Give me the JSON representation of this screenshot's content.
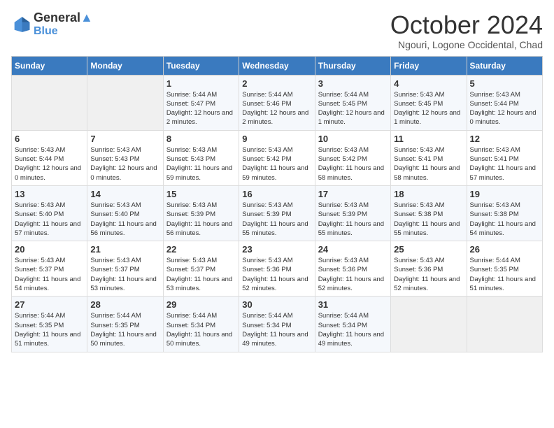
{
  "header": {
    "logo_line1": "General",
    "logo_line2": "Blue",
    "title": "October 2024",
    "subtitle": "Ngouri, Logone Occidental, Chad"
  },
  "days_of_week": [
    "Sunday",
    "Monday",
    "Tuesday",
    "Wednesday",
    "Thursday",
    "Friday",
    "Saturday"
  ],
  "weeks": [
    [
      {
        "day": "",
        "info": ""
      },
      {
        "day": "",
        "info": ""
      },
      {
        "day": "1",
        "info": "Sunrise: 5:44 AM\nSunset: 5:47 PM\nDaylight: 12 hours and 2 minutes."
      },
      {
        "day": "2",
        "info": "Sunrise: 5:44 AM\nSunset: 5:46 PM\nDaylight: 12 hours and 2 minutes."
      },
      {
        "day": "3",
        "info": "Sunrise: 5:44 AM\nSunset: 5:45 PM\nDaylight: 12 hours and 1 minute."
      },
      {
        "day": "4",
        "info": "Sunrise: 5:43 AM\nSunset: 5:45 PM\nDaylight: 12 hours and 1 minute."
      },
      {
        "day": "5",
        "info": "Sunrise: 5:43 AM\nSunset: 5:44 PM\nDaylight: 12 hours and 0 minutes."
      }
    ],
    [
      {
        "day": "6",
        "info": "Sunrise: 5:43 AM\nSunset: 5:44 PM\nDaylight: 12 hours and 0 minutes."
      },
      {
        "day": "7",
        "info": "Sunrise: 5:43 AM\nSunset: 5:43 PM\nDaylight: 12 hours and 0 minutes."
      },
      {
        "day": "8",
        "info": "Sunrise: 5:43 AM\nSunset: 5:43 PM\nDaylight: 11 hours and 59 minutes."
      },
      {
        "day": "9",
        "info": "Sunrise: 5:43 AM\nSunset: 5:42 PM\nDaylight: 11 hours and 59 minutes."
      },
      {
        "day": "10",
        "info": "Sunrise: 5:43 AM\nSunset: 5:42 PM\nDaylight: 11 hours and 58 minutes."
      },
      {
        "day": "11",
        "info": "Sunrise: 5:43 AM\nSunset: 5:41 PM\nDaylight: 11 hours and 58 minutes."
      },
      {
        "day": "12",
        "info": "Sunrise: 5:43 AM\nSunset: 5:41 PM\nDaylight: 11 hours and 57 minutes."
      }
    ],
    [
      {
        "day": "13",
        "info": "Sunrise: 5:43 AM\nSunset: 5:40 PM\nDaylight: 11 hours and 57 minutes."
      },
      {
        "day": "14",
        "info": "Sunrise: 5:43 AM\nSunset: 5:40 PM\nDaylight: 11 hours and 56 minutes."
      },
      {
        "day": "15",
        "info": "Sunrise: 5:43 AM\nSunset: 5:39 PM\nDaylight: 11 hours and 56 minutes."
      },
      {
        "day": "16",
        "info": "Sunrise: 5:43 AM\nSunset: 5:39 PM\nDaylight: 11 hours and 55 minutes."
      },
      {
        "day": "17",
        "info": "Sunrise: 5:43 AM\nSunset: 5:39 PM\nDaylight: 11 hours and 55 minutes."
      },
      {
        "day": "18",
        "info": "Sunrise: 5:43 AM\nSunset: 5:38 PM\nDaylight: 11 hours and 55 minutes."
      },
      {
        "day": "19",
        "info": "Sunrise: 5:43 AM\nSunset: 5:38 PM\nDaylight: 11 hours and 54 minutes."
      }
    ],
    [
      {
        "day": "20",
        "info": "Sunrise: 5:43 AM\nSunset: 5:37 PM\nDaylight: 11 hours and 54 minutes."
      },
      {
        "day": "21",
        "info": "Sunrise: 5:43 AM\nSunset: 5:37 PM\nDaylight: 11 hours and 53 minutes."
      },
      {
        "day": "22",
        "info": "Sunrise: 5:43 AM\nSunset: 5:37 PM\nDaylight: 11 hours and 53 minutes."
      },
      {
        "day": "23",
        "info": "Sunrise: 5:43 AM\nSunset: 5:36 PM\nDaylight: 11 hours and 52 minutes."
      },
      {
        "day": "24",
        "info": "Sunrise: 5:43 AM\nSunset: 5:36 PM\nDaylight: 11 hours and 52 minutes."
      },
      {
        "day": "25",
        "info": "Sunrise: 5:43 AM\nSunset: 5:36 PM\nDaylight: 11 hours and 52 minutes."
      },
      {
        "day": "26",
        "info": "Sunrise: 5:44 AM\nSunset: 5:35 PM\nDaylight: 11 hours and 51 minutes."
      }
    ],
    [
      {
        "day": "27",
        "info": "Sunrise: 5:44 AM\nSunset: 5:35 PM\nDaylight: 11 hours and 51 minutes."
      },
      {
        "day": "28",
        "info": "Sunrise: 5:44 AM\nSunset: 5:35 PM\nDaylight: 11 hours and 50 minutes."
      },
      {
        "day": "29",
        "info": "Sunrise: 5:44 AM\nSunset: 5:34 PM\nDaylight: 11 hours and 50 minutes."
      },
      {
        "day": "30",
        "info": "Sunrise: 5:44 AM\nSunset: 5:34 PM\nDaylight: 11 hours and 49 minutes."
      },
      {
        "day": "31",
        "info": "Sunrise: 5:44 AM\nSunset: 5:34 PM\nDaylight: 11 hours and 49 minutes."
      },
      {
        "day": "",
        "info": ""
      },
      {
        "day": "",
        "info": ""
      }
    ]
  ]
}
